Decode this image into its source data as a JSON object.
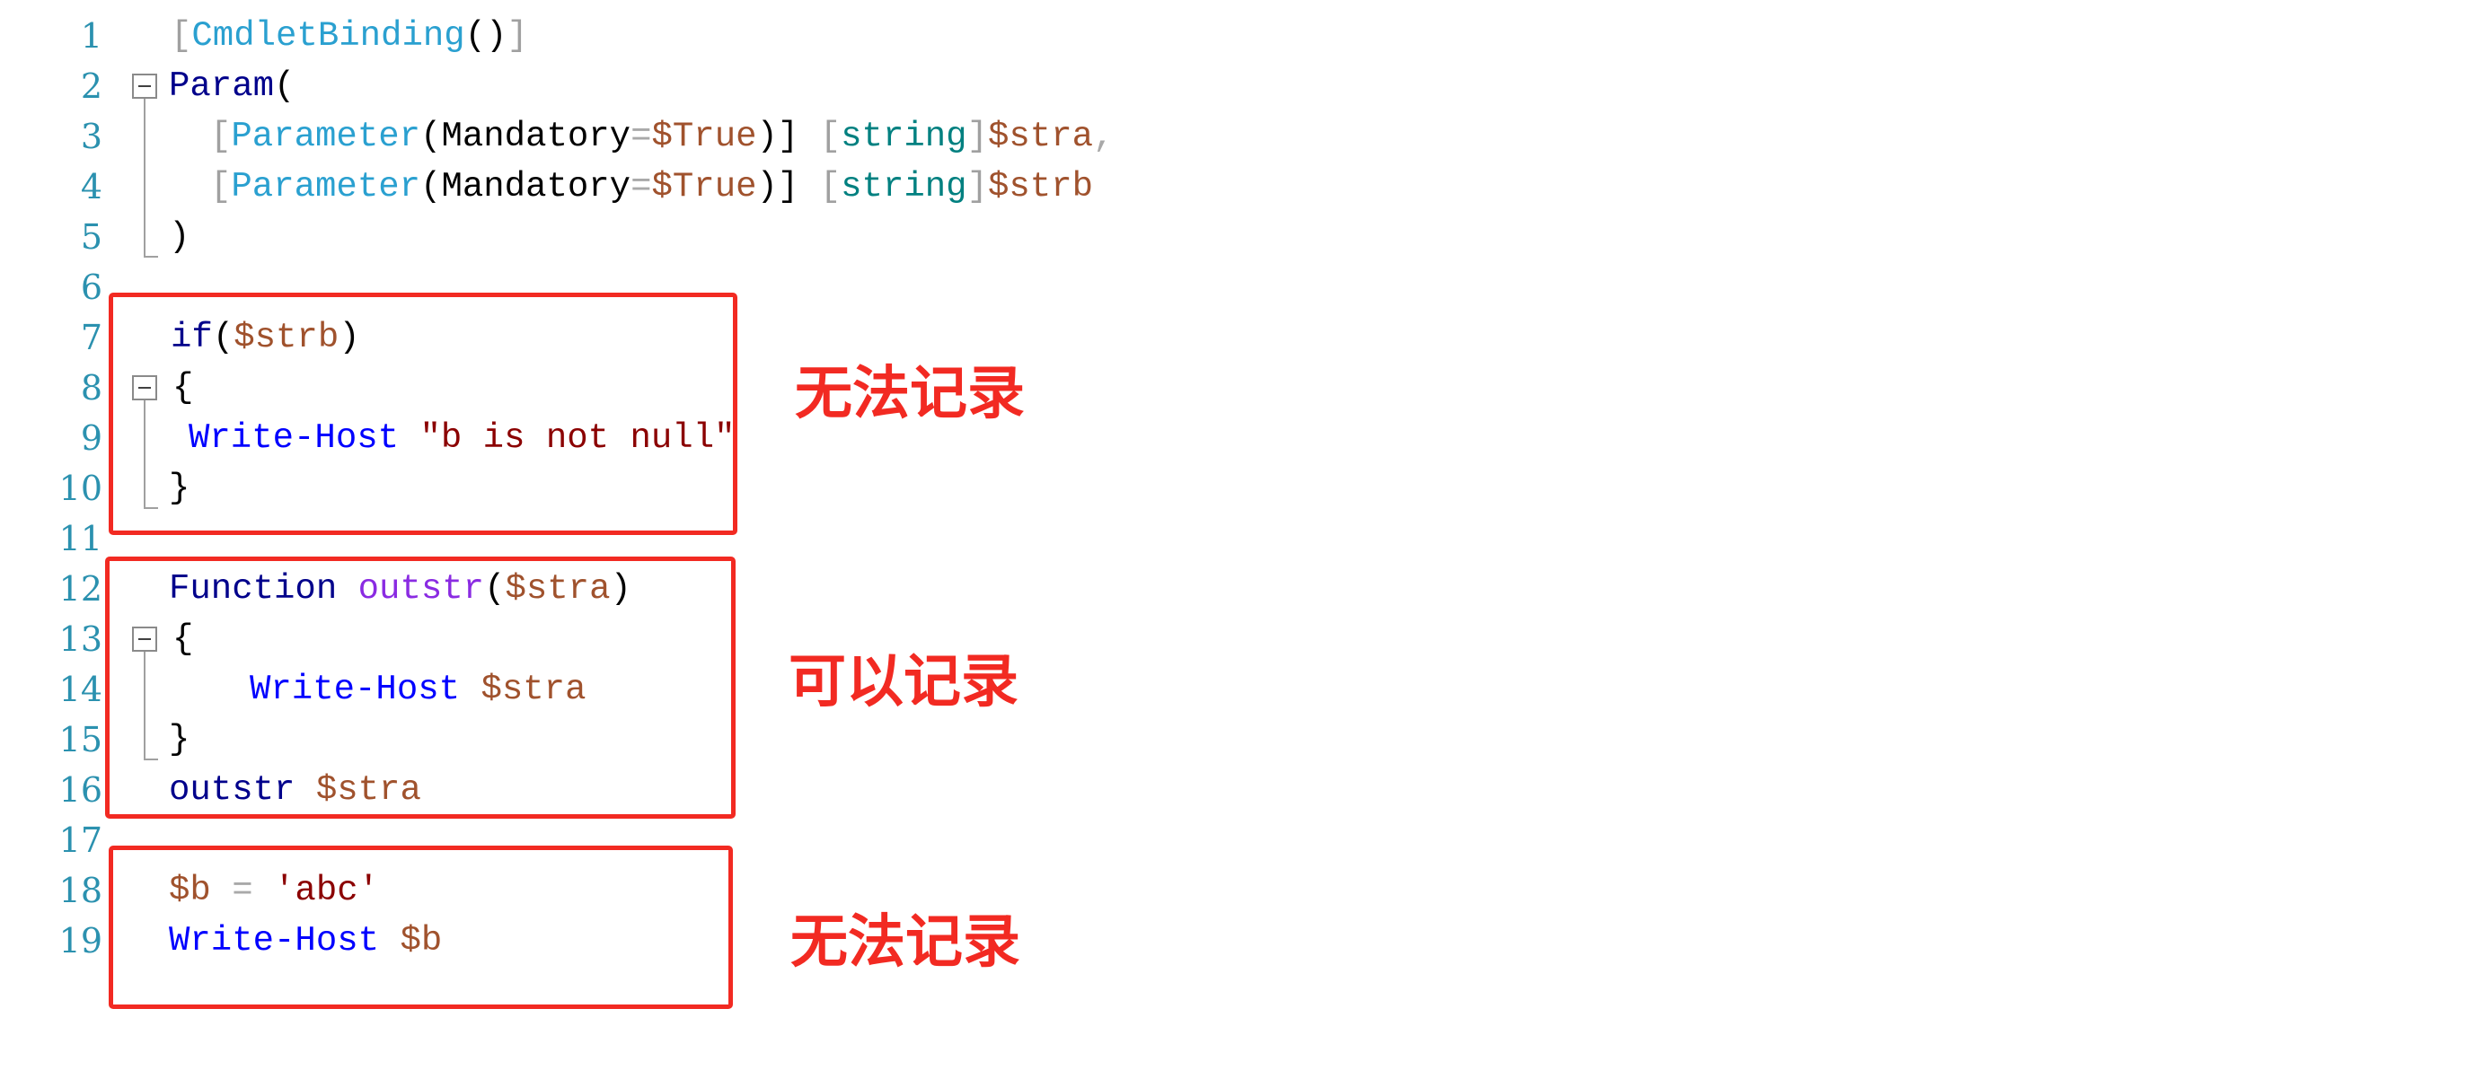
{
  "editor": {
    "line_numbers": [
      "1",
      "2",
      "3",
      "4",
      "5",
      "6",
      "7",
      "8",
      "9",
      "10",
      "11",
      "12",
      "13",
      "14",
      "15",
      "16",
      "17",
      "18",
      "19"
    ],
    "lines": {
      "l1": {
        "t1": "[",
        "t2": "CmdletBinding",
        "t3": "()",
        "t4": "]"
      },
      "l2": {
        "t1": "Param",
        "t2": "("
      },
      "l3": {
        "t1": "[",
        "t2": "Parameter",
        "t3": "(Mandatory",
        "t4": "=",
        "t5": "$True",
        "t6": ")]",
        "t7": " [",
        "t8": "string",
        "t9": "]",
        "t10": "$stra",
        "t11": ","
      },
      "l4": {
        "t1": "[",
        "t2": "Parameter",
        "t3": "(Mandatory",
        "t4": "=",
        "t5": "$True",
        "t6": ")]",
        "t7": " [",
        "t8": "string",
        "t9": "]",
        "t10": "$strb"
      },
      "l5": {
        "t1": ")"
      },
      "l7": {
        "t1": "if",
        "t2": "(",
        "t3": "$strb",
        "t4": ")"
      },
      "l8": {
        "t1": "{"
      },
      "l9": {
        "t1": "Write-Host",
        "t2": " \"b is not null\""
      },
      "l10": {
        "t1": "}"
      },
      "l12": {
        "t1": "Function",
        "t2": " outstr",
        "t3": "(",
        "t4": "$stra",
        "t5": ")"
      },
      "l13": {
        "t1": "{"
      },
      "l14": {
        "t1": "Write-Host",
        "t2": " $stra"
      },
      "l15": {
        "t1": "}"
      },
      "l16": {
        "t1": "outstr",
        "t2": " $stra"
      },
      "l18": {
        "t1": "$b",
        "t2": " = ",
        "t3": "'abc'"
      },
      "l19": {
        "t1": "Write-Host",
        "t2": " $b"
      }
    }
  },
  "annotations": {
    "box1_label": "无法记录",
    "box2_label": "可以记录",
    "box3_label": "无法记录"
  },
  "colors": {
    "annotation_red": "#f22a22",
    "line_number": "#2b91af",
    "keyword": "#00008b",
    "cmdlet": "#0000ff",
    "variable": "#a0522d",
    "string": "#8b0000",
    "function_name": "#8a2be2",
    "type": "#2aa0d0"
  },
  "icons": {
    "fold": "collapse-minus-icon"
  }
}
